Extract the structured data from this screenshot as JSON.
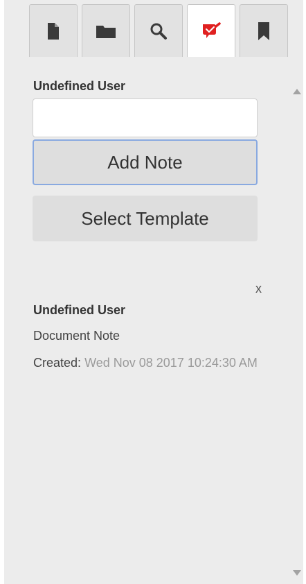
{
  "tabs": [
    {
      "icon": "document-icon",
      "active": false
    },
    {
      "icon": "folder-icon",
      "active": false
    },
    {
      "icon": "search-icon",
      "active": false
    },
    {
      "icon": "notes-check-icon",
      "active": true,
      "color": "#e02020"
    },
    {
      "icon": "bookmark-icon",
      "active": false
    }
  ],
  "form": {
    "user_label": "Undefined User",
    "note_input_value": "",
    "add_note_label": "Add Note",
    "select_template_label": "Select Template"
  },
  "note": {
    "close_label": "x",
    "user": "Undefined User",
    "type": "Document Note",
    "created_label": "Created:",
    "created_value": "Wed Nov 08 2017 10:24:30 AM"
  },
  "colors": {
    "active_icon": "#e02020",
    "icon": "#3a3a3a",
    "panel_bg": "#ececec",
    "focus_border": "#89a9e0"
  }
}
